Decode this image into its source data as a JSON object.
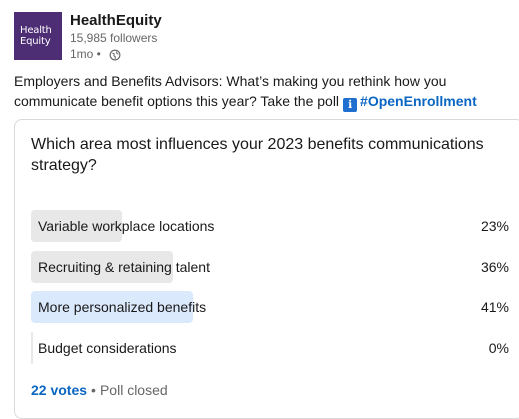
{
  "author": {
    "logo_line1": "Health",
    "logo_line2": "Equity",
    "name": "HealthEquity",
    "followers": "15,985 followers",
    "age": "1mo •",
    "visibility_icon": "globe-icon"
  },
  "post": {
    "text": "Employers and Benefits Advisors: What’s making you rethink how you communicate benefit options this year? Take the poll",
    "info_icon": "info-icon",
    "info_glyph": "ℹ",
    "hashtag": "#OpenEnrollment"
  },
  "poll": {
    "question": "Which area most influences your 2023 benefits communications strategy?",
    "options": [
      {
        "label": "Variable workplace locations",
        "percent": "23%",
        "fraction": 0.23,
        "selected": false
      },
      {
        "label": "Recruiting & retaining talent",
        "percent": "36%",
        "fraction": 0.36,
        "selected": false
      },
      {
        "label": "More personalized benefits",
        "percent": "41%",
        "fraction": 0.41,
        "selected": true
      },
      {
        "label": "Budget considerations",
        "percent": "0%",
        "fraction": 0.0,
        "selected": false
      }
    ],
    "votes": "22 votes",
    "separator": "•",
    "status": "Poll closed"
  },
  "colors": {
    "brand": "#4d2d74",
    "link": "#0a66c2",
    "bar": "#e8e8e8",
    "bar_selected": "#dbe9fc"
  }
}
